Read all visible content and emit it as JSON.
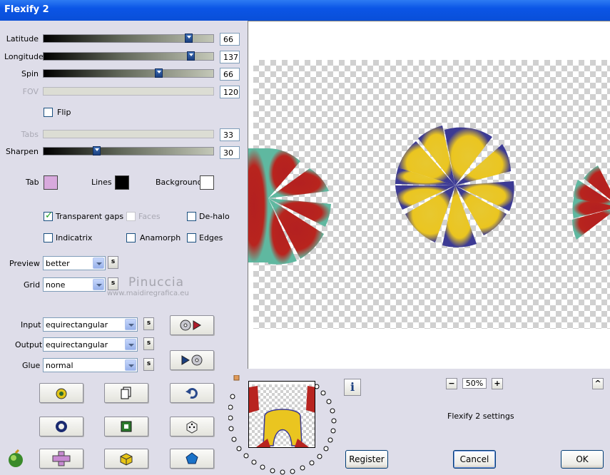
{
  "window": {
    "title": "Flexify 2"
  },
  "sliders": [
    {
      "label": "Latitude",
      "value": "66",
      "level": 0.86,
      "enabled": true
    },
    {
      "label": "Longitude",
      "value": "137",
      "level": 0.86,
      "enabled": true
    },
    {
      "label": "Spin",
      "value": "66",
      "level": 0.68,
      "enabled": true
    },
    {
      "label": "FOV",
      "value": "120",
      "level": 1.0,
      "enabled": false
    },
    {
      "label": "Tabs",
      "value": "33",
      "level": 0.0,
      "enabled": false
    },
    {
      "label": "Sharpen",
      "value": "30",
      "level": 0.3,
      "enabled": true
    }
  ],
  "flip": {
    "label": "Flip",
    "checked": false
  },
  "colors": {
    "tab": {
      "label": "Tab",
      "color": "#d8a9dd"
    },
    "lines": {
      "label": "Lines",
      "color": "#000000"
    },
    "background": {
      "label": "Background",
      "color": "#ffffff"
    }
  },
  "options": {
    "transparent_gaps": {
      "label": "Transparent gaps",
      "checked": true
    },
    "faces": {
      "label": "Faces",
      "checked": false,
      "enabled": false
    },
    "de_halo": {
      "label": "De-halo",
      "checked": false
    },
    "indicatrix": {
      "label": "Indicatrix",
      "checked": false
    },
    "anamorph": {
      "label": "Anamorph",
      "checked": false
    },
    "edges": {
      "label": "Edges",
      "checked": false
    }
  },
  "preview": {
    "label": "Preview",
    "value": "better"
  },
  "grid": {
    "label": "Grid",
    "value": "none"
  },
  "input": {
    "label": "Input",
    "value": "equirectangular"
  },
  "output": {
    "label": "Output",
    "value": "equirectangular"
  },
  "glue": {
    "label": "Glue",
    "value": "normal"
  },
  "s_label": "s",
  "watermark": {
    "line1": "Pinuccia",
    "line2": "www.maidiregrafica.eu"
  },
  "zoom": {
    "value": "50%",
    "minus": "−",
    "plus": "+"
  },
  "settings_text": "Flexify 2 settings",
  "buttons": {
    "register": "Register",
    "cancel": "Cancel",
    "ok": "OK",
    "up": "^"
  },
  "info_label": "i"
}
